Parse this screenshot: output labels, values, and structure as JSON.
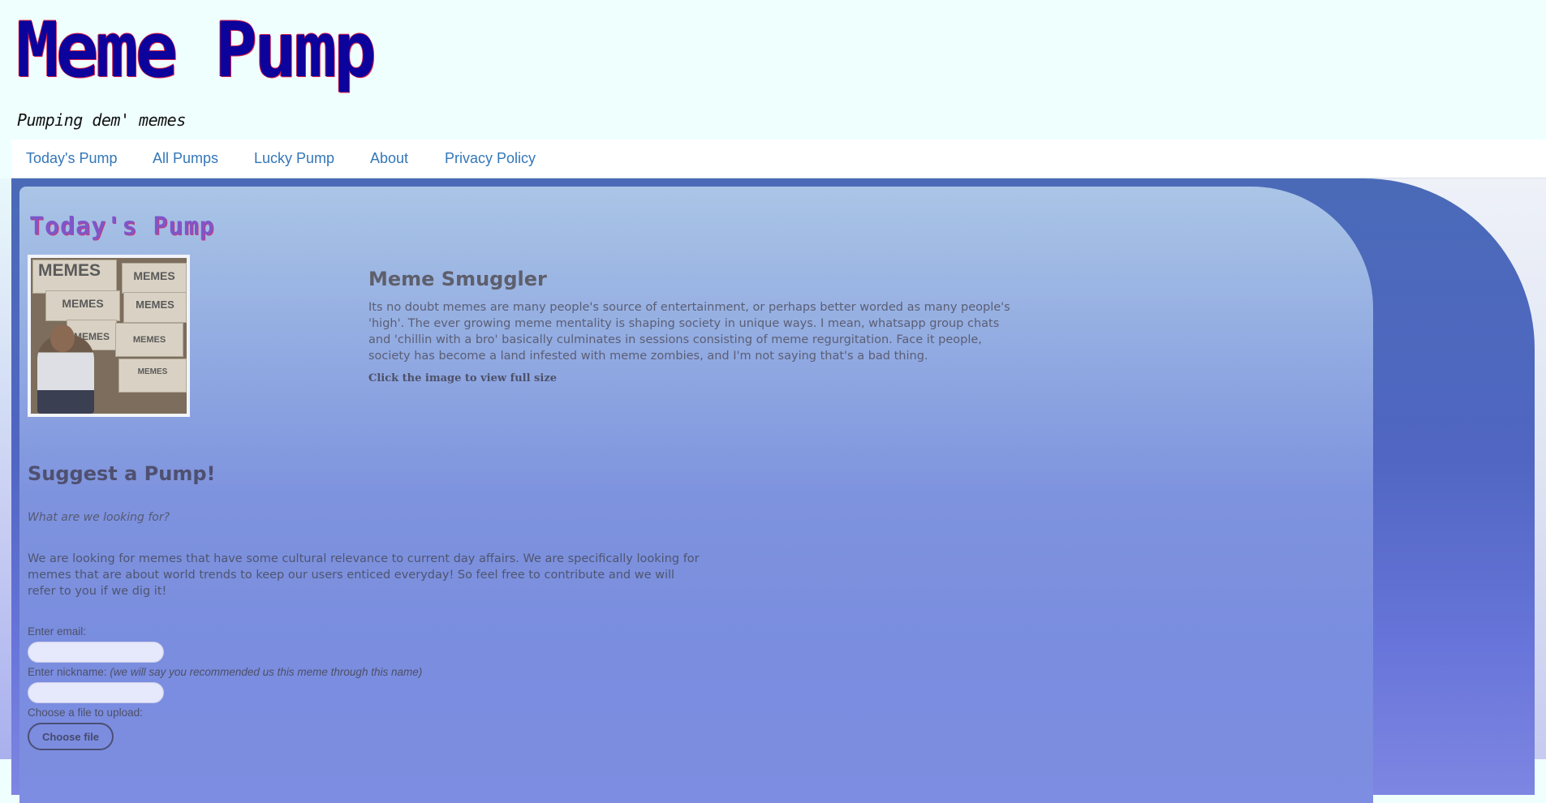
{
  "site": {
    "title": "Meme Pump",
    "tagline": "Pumping dem' memes"
  },
  "nav": {
    "items": [
      {
        "label": "Today's Pump"
      },
      {
        "label": "All Pumps"
      },
      {
        "label": "Lucky Pump"
      },
      {
        "label": "About"
      },
      {
        "label": "Privacy Policy"
      }
    ]
  },
  "main": {
    "section_title": "Today's Pump",
    "post": {
      "image_caption_words": [
        "MEMES",
        "MEMES",
        "MEMES",
        "MEMES",
        "MEMES",
        "MEMES",
        "MEMES"
      ],
      "title": "Meme Smuggler",
      "body": "Its no doubt memes are many people's source of entertainment, or perhaps better worded as many people's 'high'. The ever growing meme mentality is shaping society in unique ways. I mean, whatsapp group chats and 'chillin with a bro' basically culminates in sessions consisting of meme regurgitation. Face it people, society has become a land infested with meme zombies, and I'm not saying that's a bad thing.",
      "hint": "Click the image to view full size"
    }
  },
  "suggest": {
    "title": "Suggest a Pump!",
    "question": "What are we looking for?",
    "body": "We are looking for memes that have some cultural relevance to current day affairs. We are specifically looking for memes that are about world trends to keep our users enticed everyday! So feel free to contribute and we will refer to you if we dig it!",
    "email_label": "Enter email:",
    "email_value": "",
    "nickname_label": "Enter nickname:",
    "nickname_note": "(we will say you recommended us this meme through this name)",
    "nickname_value": "",
    "file_label": "Choose a file to upload:",
    "file_button": "Choose file"
  },
  "colors": {
    "title": "#0c029c",
    "nav_link": "#3477b8",
    "section_title": "#7e56c9"
  }
}
